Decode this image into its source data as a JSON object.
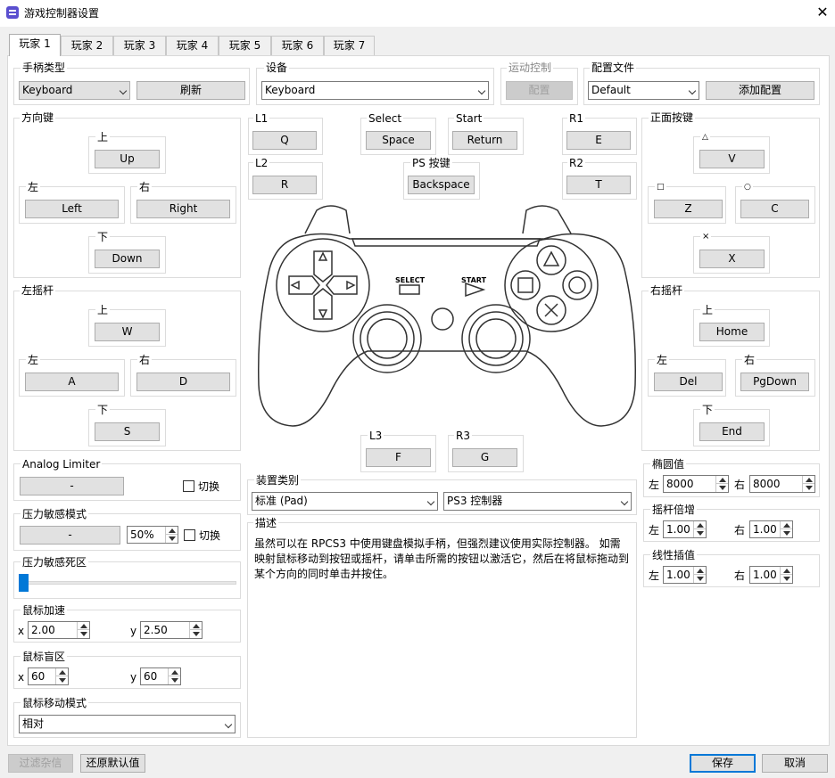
{
  "window": {
    "title": "游戏控制器设置",
    "close": "✕"
  },
  "tabs": [
    "玩家 1",
    "玩家 2",
    "玩家 3",
    "玩家 4",
    "玩家 5",
    "玩家 6",
    "玩家 7"
  ],
  "handler": {
    "title": "手柄类型",
    "value": "Keyboard",
    "refresh": "刷新"
  },
  "device": {
    "title": "设备",
    "value": "Keyboard"
  },
  "motion": {
    "title": "运动控制",
    "button": "配置"
  },
  "profile": {
    "title": "配置文件",
    "value": "Default",
    "add": "添加配置"
  },
  "dpad": {
    "title": "方向键",
    "up_label": "上",
    "up": "Up",
    "left_label": "左",
    "left": "Left",
    "right_label": "右",
    "right": "Right",
    "down_label": "下",
    "down": "Down"
  },
  "lstick": {
    "title": "左摇杆",
    "up_label": "上",
    "up": "W",
    "left_label": "左",
    "left": "A",
    "right_label": "右",
    "right": "D",
    "down_label": "下",
    "down": "S"
  },
  "face": {
    "title": "正面按键",
    "tri_label": "△",
    "tri": "V",
    "sq_label": "□",
    "sq": "Z",
    "ci_label": "○",
    "ci": "C",
    "x_label": "×",
    "x": "X"
  },
  "rstick": {
    "title": "右摇杆",
    "up_label": "上",
    "up": "Home",
    "left_label": "左",
    "left": "Del",
    "right_label": "右",
    "right": "PgDown",
    "down_label": "下",
    "down": "End"
  },
  "center": {
    "l1_label": "L1",
    "l1": "Q",
    "l2_label": "L2",
    "l2": "R",
    "select_label": "Select",
    "select": "Space",
    "start_label": "Start",
    "start": "Return",
    "ps_label": "PS 按键",
    "ps": "Backspace",
    "r1_label": "R1",
    "r1": "E",
    "r2_label": "R2",
    "r2": "T",
    "l3_label": "L3",
    "l3": "F",
    "r3_label": "R3",
    "r3": "G",
    "pad_select": "SELECT",
    "pad_start": "START"
  },
  "analog_limiter": {
    "title": "Analog Limiter",
    "button": "-",
    "toggle": "切换"
  },
  "pressure_mode": {
    "title": "压力敏感模式",
    "button": "-",
    "percent": "50%",
    "toggle": "切换"
  },
  "pressure_deadzone": {
    "title": "压力敏感死区",
    "value": 0.0
  },
  "mouse_accel": {
    "title": "鼠标加速",
    "x_label": "x",
    "x": "2.00",
    "y_label": "y",
    "y": "2.50"
  },
  "mouse_deadzone": {
    "title": "鼠标盲区",
    "x_label": "x",
    "x": "60",
    "y_label": "y",
    "y": "60"
  },
  "mouse_move": {
    "title": "鼠标移动模式",
    "value": "相对"
  },
  "device_class": {
    "title": "装置类别",
    "type": "标准 (Pad)",
    "model": "PS3 控制器"
  },
  "description": {
    "title": "描述",
    "text": "虽然可以在 RPCS3 中使用键盘模拟手柄，但强烈建议使用实际控制器。 如需映射鼠标移动到按钮或摇杆，请单击所需的按钮以激活它，然后在将鼠标拖动到某个方向的同时单击并按住。"
  },
  "ellipse": {
    "title": "椭圆值",
    "left_label": "左",
    "left": "8000",
    "right_label": "右",
    "right": "8000"
  },
  "stick_mult": {
    "title": "摇杆倍增",
    "left_label": "左",
    "left": "1.00",
    "right_label": "右",
    "right": "1.00"
  },
  "lerp": {
    "title": "线性插值",
    "left_label": "左",
    "left": "1.00",
    "right_label": "右",
    "right": "1.00"
  },
  "footer": {
    "filter": "过滤杂信",
    "restore": "还原默认值",
    "save": "保存",
    "cancel": "取消"
  },
  "colors": {
    "accent": "#0078d7",
    "window_bg": "#f0f0f0"
  }
}
